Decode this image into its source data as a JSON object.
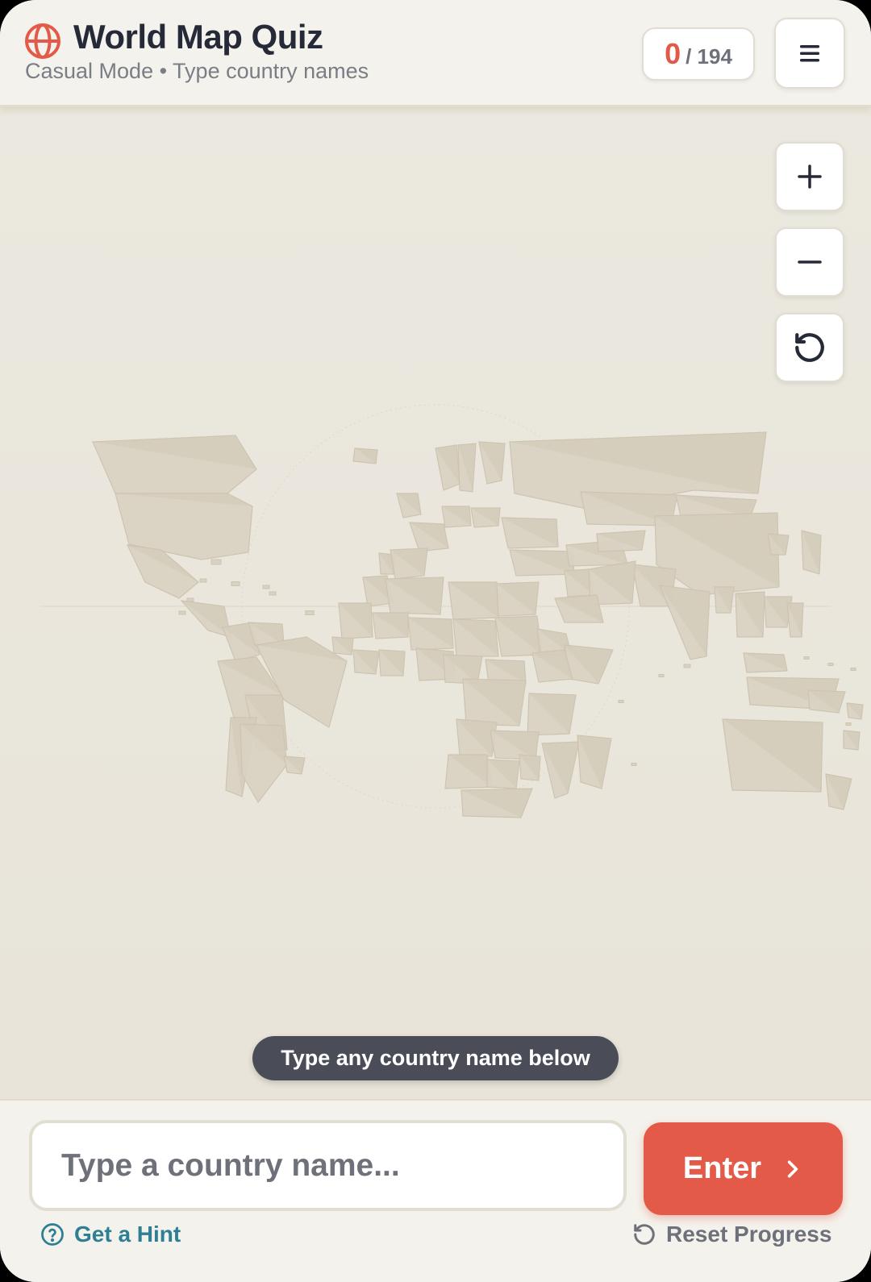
{
  "header": {
    "title": "World Map Quiz",
    "subtitle": "Casual Mode • Type country names",
    "logo_icon": "globe-icon",
    "menu_icon": "hamburger-menu-icon"
  },
  "score": {
    "current": "0",
    "total": "/ 194"
  },
  "map_controls": [
    {
      "name": "zoom-in",
      "icon": "plus-icon"
    },
    {
      "name": "zoom-out",
      "icon": "minus-icon"
    },
    {
      "name": "reset-view",
      "icon": "rotate-ccw-icon"
    }
  ],
  "toast": {
    "text": "Type any country name below"
  },
  "input": {
    "placeholder": "Type a country name...",
    "value": ""
  },
  "enter_button": {
    "label": "Enter",
    "icon": "chevron-right-icon"
  },
  "links": {
    "hint": "Get a Hint",
    "hint_icon": "help-circle-icon",
    "reset": "Reset Progress",
    "reset_icon": "rotate-ccw-icon"
  },
  "colors": {
    "accent": "#e35a48",
    "hint_link": "#2f7f94",
    "title": "#262a38",
    "map_background": "#ebe8df",
    "country_fill": "#d9d2c2",
    "country_stroke": "#cdc4b0"
  }
}
